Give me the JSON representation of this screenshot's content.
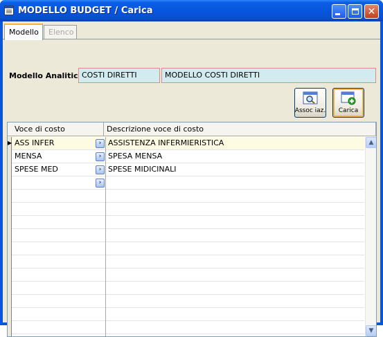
{
  "window": {
    "title": "MODELLO BUDGET / Carica",
    "controls": {
      "minimize": "_",
      "maximize": "□",
      "close": "✕"
    }
  },
  "tabs": [
    {
      "label": "Modello",
      "active": true
    },
    {
      "label": "Elenco",
      "active": false
    }
  ],
  "model": {
    "label": "Modello Analitico:",
    "code": "COSTI DIRETTI",
    "description": "MODELLO COSTI DIRETTI"
  },
  "toolbar": {
    "associate_label": "Assoc iaz.",
    "load_label": "Carica"
  },
  "grid": {
    "columns": [
      "Voce di costo",
      "Descrizione voce di costo"
    ],
    "rows": [
      {
        "code": "ASS INFER",
        "description": "ASSISTENZA INFERMIERISTICA"
      },
      {
        "code": "MENSA",
        "description": "SPESA MENSA"
      },
      {
        "code": "SPESE MED",
        "description": "SPESE MIDICINALI"
      },
      {
        "code": "",
        "description": ""
      }
    ],
    "selected_row": 0
  },
  "colors": {
    "titlebar": "#0a55d8",
    "field_bg": "#d2ebee",
    "field_border": "#e08a8a",
    "selected_row": "#fdfbe1"
  }
}
